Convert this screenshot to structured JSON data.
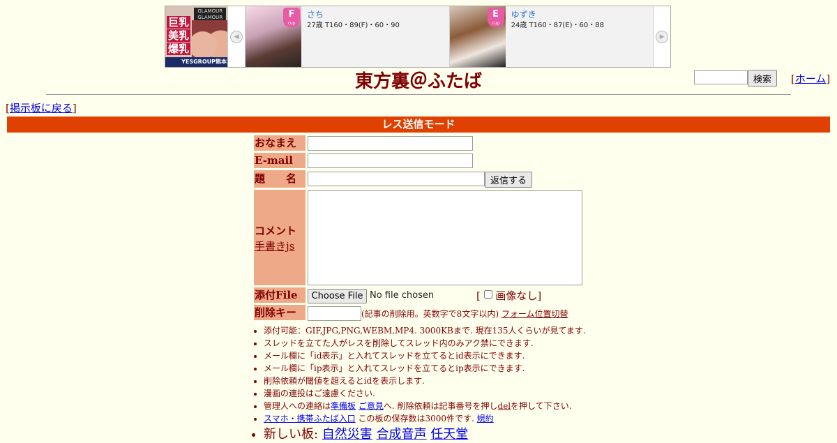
{
  "banner": {
    "brand": {
      "tagline": "GLAMOUR GLAMOUR",
      "kanji": [
        "巨乳",
        "美乳",
        "爆乳"
      ],
      "group": "YESGROUP熊本"
    },
    "girls": [
      {
        "name": "さち",
        "stats": "27歳 T160・89(F)・60・90",
        "cup": "F"
      },
      {
        "name": "ゆずき",
        "stats": "24歳 T160・87(E)・60・88",
        "cup": "E"
      }
    ],
    "cup_suffix": "cup"
  },
  "header": {
    "title": "東方裏＠ふたば",
    "search_button": "検索",
    "home_link": "ホーム",
    "back_link": "掲示板に戻る"
  },
  "mode_bar": "レス送信モード",
  "form": {
    "name_label": "おなまえ",
    "email_label": "E-mail",
    "subject_label": "題　　名",
    "submit_button": "返信する",
    "comment_label": "コメント",
    "handwriting_link": "手書きjs",
    "file_label": "添付File",
    "choose_file_button": "Choose File",
    "no_file_text": "No file chosen",
    "no_image_label": "画像なし",
    "delete_key_label": "削除キー",
    "delete_key_note": "(記事の削除用。英数字で8文字以内)",
    "form_position_link": "フォーム位置切替"
  },
  "notes": {
    "n1": "添付可能：GIF,JPG,PNG,WEBM,MP4. 3000KBまで. 現在135人くらいが見てます.",
    "n2": "スレッドを立てた人がレスを削除してスレッド内のみアク禁にできます.",
    "n3": "メール欄に「id表示」と入れてスレッドを立てるとid表示にできます.",
    "n4": "メール欄に「ip表示」と入れてスレッドを立てるとip表示にできます.",
    "n5": "削除依頼が閾値を超えるとidを表示します.",
    "n6": "漫画の連投はご遠慮ください.",
    "n7_prefix": "管理人への連絡は",
    "n7_link1": "準備板",
    "n7_link2": "ご意見",
    "n7_mid": "へ. 削除依頼は記事番号を押し",
    "n7_del": "del",
    "n7_suffix": "を押して下さい.",
    "n8_link": "スマホ・携帯ふたば入口",
    "n8_mid": " この板の保存数は3000件です. ",
    "n8_rules": "規約",
    "n9_prefix": "新しい板: ",
    "n9_links": [
      "自然災害",
      "合成音声",
      "任天堂"
    ]
  },
  "colors": {
    "background": "#ffffee",
    "text": "#800000",
    "mode_bar": "#e04000",
    "label_bg": "#eeaa88"
  }
}
